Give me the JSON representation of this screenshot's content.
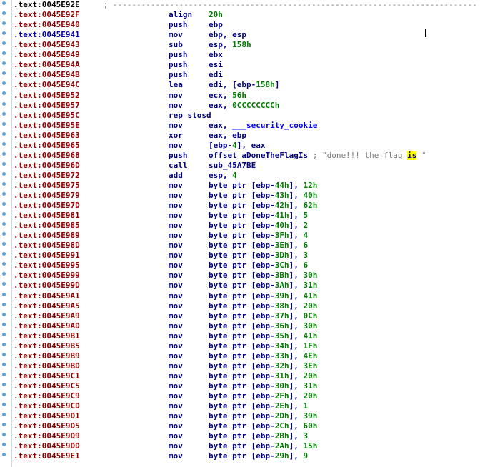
{
  "view": {
    "separator_addr": ".text:0045E92E",
    "separator_text": " ; ---------------------------------------------------------------------------------------------",
    "lines": [
      {
        "addr": ".text:0045E92F",
        "mnem": "align",
        "ops": [
          {
            "t": "20h",
            "k": "num"
          }
        ],
        "ops_before": "",
        "cls": ""
      },
      {
        "addr": ".text:0045E940",
        "mnem": "push",
        "ops": [
          {
            "t": "ebp",
            "k": "reg"
          }
        ],
        "cls": ""
      },
      {
        "addr": ".text:0045E941",
        "mnem": "mov",
        "ops": [
          {
            "t": "ebp, esp",
            "k": "reg"
          }
        ],
        "cls": "cur"
      },
      {
        "addr": ".text:0045E943",
        "mnem": "sub",
        "ops": [
          {
            "t": "esp, ",
            "k": "reg"
          },
          {
            "t": "158h",
            "k": "num"
          }
        ],
        "cls": ""
      },
      {
        "addr": ".text:0045E949",
        "mnem": "push",
        "ops": [
          {
            "t": "ebx",
            "k": "reg"
          }
        ],
        "cls": ""
      },
      {
        "addr": ".text:0045E94A",
        "mnem": "push",
        "ops": [
          {
            "t": "esi",
            "k": "reg"
          }
        ],
        "cls": ""
      },
      {
        "addr": ".text:0045E94B",
        "mnem": "push",
        "ops": [
          {
            "t": "edi",
            "k": "reg"
          }
        ],
        "cls": ""
      },
      {
        "addr": ".text:0045E94C",
        "mnem": "lea",
        "ops": [
          {
            "t": "edi, [ebp-",
            "k": "reg"
          },
          {
            "t": "158h",
            "k": "num"
          },
          {
            "t": "]",
            "k": "reg"
          }
        ],
        "cls": ""
      },
      {
        "addr": ".text:0045E952",
        "mnem": "mov",
        "ops": [
          {
            "t": "ecx, ",
            "k": "reg"
          },
          {
            "t": "56h",
            "k": "num"
          }
        ],
        "cls": ""
      },
      {
        "addr": ".text:0045E957",
        "mnem": "mov",
        "ops": [
          {
            "t": "eax, ",
            "k": "reg"
          },
          {
            "t": "0CCCCCCCCh",
            "k": "num"
          }
        ],
        "cls": ""
      },
      {
        "addr": ".text:0045E95C",
        "mnem": "rep stosd",
        "ops": [],
        "cls": ""
      },
      {
        "addr": ".text:0045E95E",
        "mnem": "mov",
        "ops": [
          {
            "t": "eax, ",
            "k": "reg"
          },
          {
            "t": "___security_cookie",
            "k": "name"
          }
        ],
        "cls": ""
      },
      {
        "addr": ".text:0045E963",
        "mnem": "xor",
        "ops": [
          {
            "t": "eax, ebp",
            "k": "reg"
          }
        ],
        "cls": ""
      },
      {
        "addr": ".text:0045E965",
        "mnem": "mov",
        "ops": [
          {
            "t": "[ebp-",
            "k": "reg"
          },
          {
            "t": "4",
            "k": "num"
          },
          {
            "t": "], eax",
            "k": "reg"
          }
        ],
        "cls": ""
      },
      {
        "addr": ".text:0045E968",
        "mnem": "push",
        "ops": [
          {
            "t": "offset aDoneTheFlagIs ",
            "k": "reg"
          },
          {
            "t": "; \"done!!! the flag ",
            "k": "cmt"
          },
          {
            "t": "is",
            "k": "hl"
          },
          {
            "t": " \"",
            "k": "cmt"
          }
        ],
        "cls": ""
      },
      {
        "addr": ".text:0045E96D",
        "mnem": "call",
        "ops": [
          {
            "t": "sub_45A7BE",
            "k": "reg"
          }
        ],
        "cls": ""
      },
      {
        "addr": ".text:0045E972",
        "mnem": "add",
        "ops": [
          {
            "t": "esp, ",
            "k": "reg"
          },
          {
            "t": "4",
            "k": "num"
          }
        ],
        "cls": ""
      },
      {
        "addr": ".text:0045E975",
        "mnem": "mov",
        "ops": [
          {
            "t": "byte ptr [ebp-",
            "k": "reg"
          },
          {
            "t": "44h",
            "k": "num"
          },
          {
            "t": "], ",
            "k": "reg"
          },
          {
            "t": "12h",
            "k": "num"
          }
        ],
        "cls": ""
      },
      {
        "addr": ".text:0045E979",
        "mnem": "mov",
        "ops": [
          {
            "t": "byte ptr [ebp-",
            "k": "reg"
          },
          {
            "t": "43h",
            "k": "num"
          },
          {
            "t": "], ",
            "k": "reg"
          },
          {
            "t": "40h",
            "k": "num"
          }
        ],
        "cls": ""
      },
      {
        "addr": ".text:0045E97D",
        "mnem": "mov",
        "ops": [
          {
            "t": "byte ptr [ebp-",
            "k": "reg"
          },
          {
            "t": "42h",
            "k": "num"
          },
          {
            "t": "], ",
            "k": "reg"
          },
          {
            "t": "62h",
            "k": "num"
          }
        ],
        "cls": ""
      },
      {
        "addr": ".text:0045E981",
        "mnem": "mov",
        "ops": [
          {
            "t": "byte ptr [ebp-",
            "k": "reg"
          },
          {
            "t": "41h",
            "k": "num"
          },
          {
            "t": "], ",
            "k": "reg"
          },
          {
            "t": "5",
            "k": "num"
          }
        ],
        "cls": ""
      },
      {
        "addr": ".text:0045E985",
        "mnem": "mov",
        "ops": [
          {
            "t": "byte ptr [ebp-",
            "k": "reg"
          },
          {
            "t": "40h",
            "k": "num"
          },
          {
            "t": "], ",
            "k": "reg"
          },
          {
            "t": "2",
            "k": "num"
          }
        ],
        "cls": ""
      },
      {
        "addr": ".text:0045E989",
        "mnem": "mov",
        "ops": [
          {
            "t": "byte ptr [ebp-",
            "k": "reg"
          },
          {
            "t": "3Fh",
            "k": "num"
          },
          {
            "t": "], ",
            "k": "reg"
          },
          {
            "t": "4",
            "k": "num"
          }
        ],
        "cls": ""
      },
      {
        "addr": ".text:0045E98D",
        "mnem": "mov",
        "ops": [
          {
            "t": "byte ptr [ebp-",
            "k": "reg"
          },
          {
            "t": "3Eh",
            "k": "num"
          },
          {
            "t": "], ",
            "k": "reg"
          },
          {
            "t": "6",
            "k": "num"
          }
        ],
        "cls": ""
      },
      {
        "addr": ".text:0045E991",
        "mnem": "mov",
        "ops": [
          {
            "t": "byte ptr [ebp-",
            "k": "reg"
          },
          {
            "t": "3Dh",
            "k": "num"
          },
          {
            "t": "], ",
            "k": "reg"
          },
          {
            "t": "3",
            "k": "num"
          }
        ],
        "cls": ""
      },
      {
        "addr": ".text:0045E995",
        "mnem": "mov",
        "ops": [
          {
            "t": "byte ptr [ebp-",
            "k": "reg"
          },
          {
            "t": "3Ch",
            "k": "num"
          },
          {
            "t": "], ",
            "k": "reg"
          },
          {
            "t": "6",
            "k": "num"
          }
        ],
        "cls": ""
      },
      {
        "addr": ".text:0045E999",
        "mnem": "mov",
        "ops": [
          {
            "t": "byte ptr [ebp-",
            "k": "reg"
          },
          {
            "t": "3Bh",
            "k": "num"
          },
          {
            "t": "], ",
            "k": "reg"
          },
          {
            "t": "30h",
            "k": "num"
          }
        ],
        "cls": ""
      },
      {
        "addr": ".text:0045E99D",
        "mnem": "mov",
        "ops": [
          {
            "t": "byte ptr [ebp-",
            "k": "reg"
          },
          {
            "t": "3Ah",
            "k": "num"
          },
          {
            "t": "], ",
            "k": "reg"
          },
          {
            "t": "31h",
            "k": "num"
          }
        ],
        "cls": ""
      },
      {
        "addr": ".text:0045E9A1",
        "mnem": "mov",
        "ops": [
          {
            "t": "byte ptr [ebp-",
            "k": "reg"
          },
          {
            "t": "39h",
            "k": "num"
          },
          {
            "t": "], ",
            "k": "reg"
          },
          {
            "t": "41h",
            "k": "num"
          }
        ],
        "cls": ""
      },
      {
        "addr": ".text:0045E9A5",
        "mnem": "mov",
        "ops": [
          {
            "t": "byte ptr [ebp-",
            "k": "reg"
          },
          {
            "t": "38h",
            "k": "num"
          },
          {
            "t": "], ",
            "k": "reg"
          },
          {
            "t": "20h",
            "k": "num"
          }
        ],
        "cls": ""
      },
      {
        "addr": ".text:0045E9A9",
        "mnem": "mov",
        "ops": [
          {
            "t": "byte ptr [ebp-",
            "k": "reg"
          },
          {
            "t": "37h",
            "k": "num"
          },
          {
            "t": "], ",
            "k": "reg"
          },
          {
            "t": "0Ch",
            "k": "num"
          }
        ],
        "cls": ""
      },
      {
        "addr": ".text:0045E9AD",
        "mnem": "mov",
        "ops": [
          {
            "t": "byte ptr [ebp-",
            "k": "reg"
          },
          {
            "t": "36h",
            "k": "num"
          },
          {
            "t": "], ",
            "k": "reg"
          },
          {
            "t": "30h",
            "k": "num"
          }
        ],
        "cls": ""
      },
      {
        "addr": ".text:0045E9B1",
        "mnem": "mov",
        "ops": [
          {
            "t": "byte ptr [ebp-",
            "k": "reg"
          },
          {
            "t": "35h",
            "k": "num"
          },
          {
            "t": "], ",
            "k": "reg"
          },
          {
            "t": "41h",
            "k": "num"
          }
        ],
        "cls": ""
      },
      {
        "addr": ".text:0045E9B5",
        "mnem": "mov",
        "ops": [
          {
            "t": "byte ptr [ebp-",
            "k": "reg"
          },
          {
            "t": "34h",
            "k": "num"
          },
          {
            "t": "], ",
            "k": "reg"
          },
          {
            "t": "1Fh",
            "k": "num"
          }
        ],
        "cls": ""
      },
      {
        "addr": ".text:0045E9B9",
        "mnem": "mov",
        "ops": [
          {
            "t": "byte ptr [ebp-",
            "k": "reg"
          },
          {
            "t": "33h",
            "k": "num"
          },
          {
            "t": "], ",
            "k": "reg"
          },
          {
            "t": "4Eh",
            "k": "num"
          }
        ],
        "cls": ""
      },
      {
        "addr": ".text:0045E9BD",
        "mnem": "mov",
        "ops": [
          {
            "t": "byte ptr [ebp-",
            "k": "reg"
          },
          {
            "t": "32h",
            "k": "num"
          },
          {
            "t": "], ",
            "k": "reg"
          },
          {
            "t": "3Eh",
            "k": "num"
          }
        ],
        "cls": ""
      },
      {
        "addr": ".text:0045E9C1",
        "mnem": "mov",
        "ops": [
          {
            "t": "byte ptr [ebp-",
            "k": "reg"
          },
          {
            "t": "31h",
            "k": "num"
          },
          {
            "t": "], ",
            "k": "reg"
          },
          {
            "t": "20h",
            "k": "num"
          }
        ],
        "cls": ""
      },
      {
        "addr": ".text:0045E9C5",
        "mnem": "mov",
        "ops": [
          {
            "t": "byte ptr [ebp-",
            "k": "reg"
          },
          {
            "t": "30h",
            "k": "num"
          },
          {
            "t": "], ",
            "k": "reg"
          },
          {
            "t": "31h",
            "k": "num"
          }
        ],
        "cls": ""
      },
      {
        "addr": ".text:0045E9C9",
        "mnem": "mov",
        "ops": [
          {
            "t": "byte ptr [ebp-",
            "k": "reg"
          },
          {
            "t": "2Fh",
            "k": "num"
          },
          {
            "t": "], ",
            "k": "reg"
          },
          {
            "t": "20h",
            "k": "num"
          }
        ],
        "cls": ""
      },
      {
        "addr": ".text:0045E9CD",
        "mnem": "mov",
        "ops": [
          {
            "t": "byte ptr [ebp-",
            "k": "reg"
          },
          {
            "t": "2Eh",
            "k": "num"
          },
          {
            "t": "], ",
            "k": "reg"
          },
          {
            "t": "1",
            "k": "num"
          }
        ],
        "cls": ""
      },
      {
        "addr": ".text:0045E9D1",
        "mnem": "mov",
        "ops": [
          {
            "t": "byte ptr [ebp-",
            "k": "reg"
          },
          {
            "t": "2Dh",
            "k": "num"
          },
          {
            "t": "], ",
            "k": "reg"
          },
          {
            "t": "39h",
            "k": "num"
          }
        ],
        "cls": ""
      },
      {
        "addr": ".text:0045E9D5",
        "mnem": "mov",
        "ops": [
          {
            "t": "byte ptr [ebp-",
            "k": "reg"
          },
          {
            "t": "2Ch",
            "k": "num"
          },
          {
            "t": "], ",
            "k": "reg"
          },
          {
            "t": "60h",
            "k": "num"
          }
        ],
        "cls": ""
      },
      {
        "addr": ".text:0045E9D9",
        "mnem": "mov",
        "ops": [
          {
            "t": "byte ptr [ebp-",
            "k": "reg"
          },
          {
            "t": "2Bh",
            "k": "num"
          },
          {
            "t": "], ",
            "k": "reg"
          },
          {
            "t": "3",
            "k": "num"
          }
        ],
        "cls": ""
      },
      {
        "addr": ".text:0045E9DD",
        "mnem": "mov",
        "ops": [
          {
            "t": "byte ptr [ebp-",
            "k": "reg"
          },
          {
            "t": "2Ah",
            "k": "num"
          },
          {
            "t": "], ",
            "k": "reg"
          },
          {
            "t": "15h",
            "k": "num"
          }
        ],
        "cls": ""
      },
      {
        "addr": ".text:0045E9E1",
        "mnem": "mov",
        "ops": [
          {
            "t": "byte ptr [ebp-",
            "k": "reg"
          },
          {
            "t": "29h",
            "k": "num"
          },
          {
            "t": "], ",
            "k": "reg"
          },
          {
            "t": "9",
            "k": "num"
          }
        ],
        "cls": ""
      }
    ]
  }
}
